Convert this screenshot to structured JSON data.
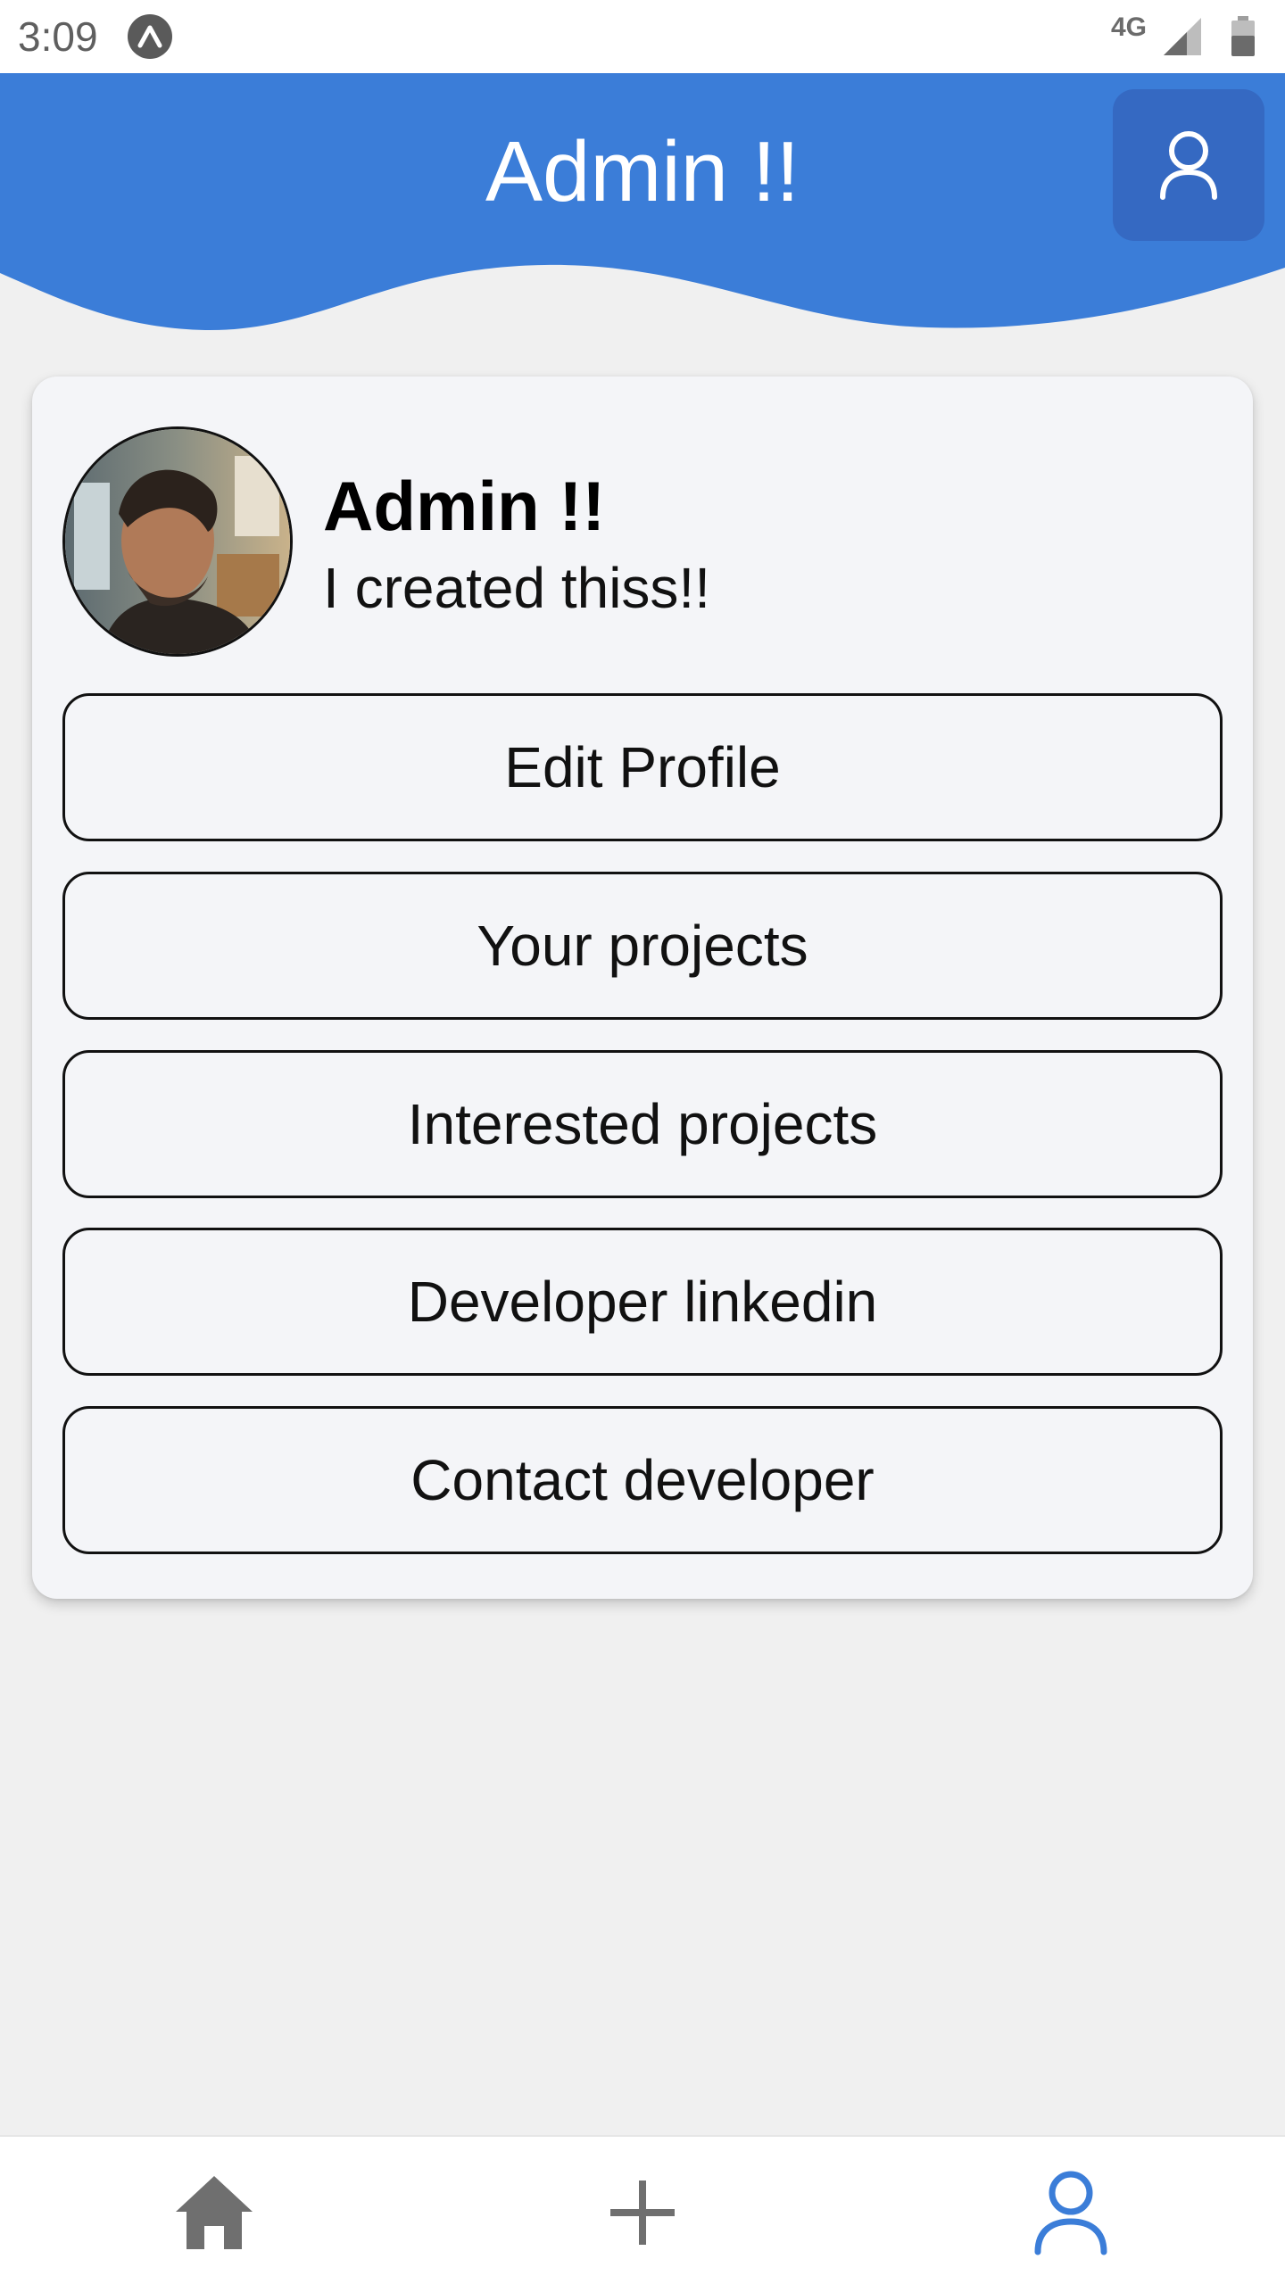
{
  "status_bar": {
    "time": "3:09",
    "network": "4G",
    "app_icon": "app-arc-icon",
    "signal_icon": "signal-icon",
    "battery_icon": "battery-icon"
  },
  "header": {
    "title": "Admin !!",
    "user_button_icon": "user-icon",
    "color": "#3b7dd8"
  },
  "profile": {
    "name": "Admin !!",
    "bio": "I created thiss!!",
    "avatar_icon": "avatar-photo"
  },
  "menu": {
    "items": [
      {
        "label": "Edit Profile"
      },
      {
        "label": "Your projects"
      },
      {
        "label": "Interested projects"
      },
      {
        "label": "Developer linkedin"
      },
      {
        "label": "Contact developer"
      }
    ]
  },
  "bottom_nav": {
    "items": [
      {
        "icon": "home-icon",
        "active": false
      },
      {
        "icon": "plus-icon",
        "active": false
      },
      {
        "icon": "user-icon",
        "active": true
      }
    ],
    "active_color": "#3b7dd8",
    "inactive_color": "#6f6f6f"
  }
}
